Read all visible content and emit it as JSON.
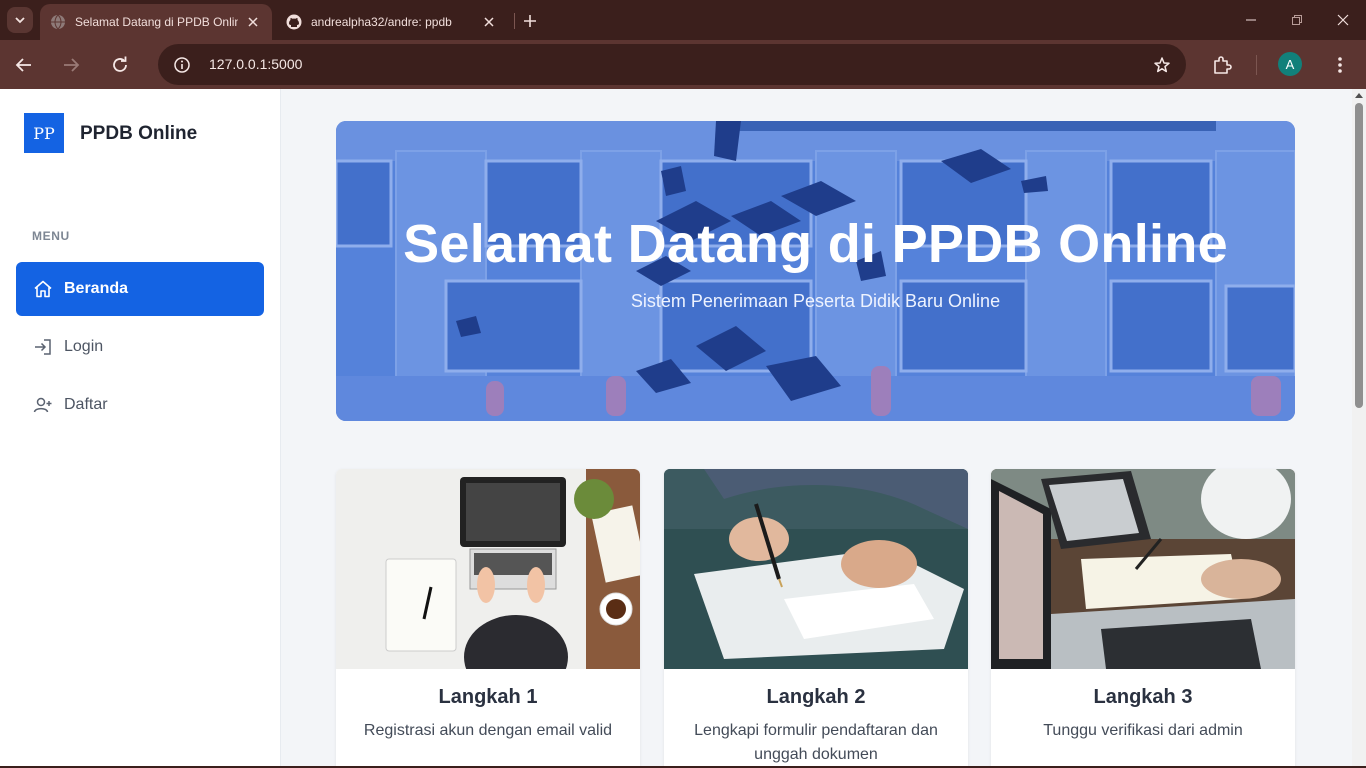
{
  "browser": {
    "tabs": [
      {
        "title": "Selamat Datang di PPDB Online",
        "active": true
      },
      {
        "title": "andrealpha32/andre: ppdb",
        "active": false
      }
    ],
    "url": "127.0.0.1:5000",
    "profile_initial": "A"
  },
  "sidebar": {
    "logo_text": "PP",
    "brand": "PPDB Online",
    "menu_heading": "MENU",
    "items": [
      {
        "label": "Beranda",
        "icon": "home-icon",
        "active": true
      },
      {
        "label": "Login",
        "icon": "login-icon",
        "active": false
      },
      {
        "label": "Daftar",
        "icon": "user-plus-icon",
        "active": false
      }
    ]
  },
  "hero": {
    "title": "Selamat Datang di PPDB Online",
    "subtitle": "Sistem Penerimaan Peserta Didik Baru Online"
  },
  "steps": [
    {
      "title": "Langkah 1",
      "description": "Registrasi akun dengan email valid"
    },
    {
      "title": "Langkah 2",
      "description": "Lengkapi formulir pendaftaran dan unggah dokumen"
    },
    {
      "title": "Langkah 3",
      "description": "Tunggu verifikasi dari admin"
    }
  ],
  "colors": {
    "primary": "#1463e3",
    "browser_frame": "#3b1f1c",
    "page_background": "#f3f5f8"
  }
}
